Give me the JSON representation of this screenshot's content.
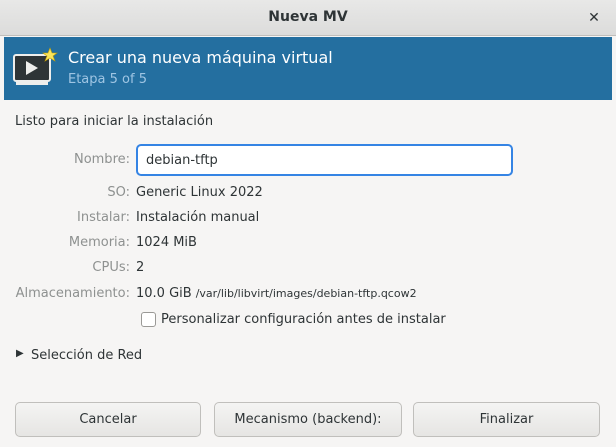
{
  "window": {
    "title": "Nueva MV",
    "close_icon": "close-icon"
  },
  "banner": {
    "heading": "Crear una nueva máquina virtual",
    "step": "Etapa 5 of 5",
    "icon": "vm-monitor-icon",
    "background": "#246fa0"
  },
  "summary": {
    "ready_text": "Listo para iniciar la instalación",
    "name_label": "Nombre:",
    "name_value": "debian-tftp",
    "os_label": "SO:",
    "os_value": "Generic Linux 2022",
    "install_label": "Instalar:",
    "install_value": "Instalación manual",
    "memory_label": "Memoria:",
    "memory_value": "1024 MiB",
    "cpus_label": "CPUs:",
    "cpus_value": "2",
    "storage_label": "Almacenamiento:",
    "storage_size": "10.0 GiB",
    "storage_path": "/var/lib/libvirt/images/debian-tftp.qcow2"
  },
  "customize": {
    "label": "Personalizar configuración antes de instalar",
    "checked": false
  },
  "network": {
    "label": "Selección de Red",
    "expanded": false
  },
  "buttons": {
    "cancel": "Cancelar",
    "backend": "Mecanismo (backend):",
    "finish": "Finalizar"
  },
  "colors": {
    "accent": "#3584e4",
    "label_gray": "#8e9190"
  }
}
